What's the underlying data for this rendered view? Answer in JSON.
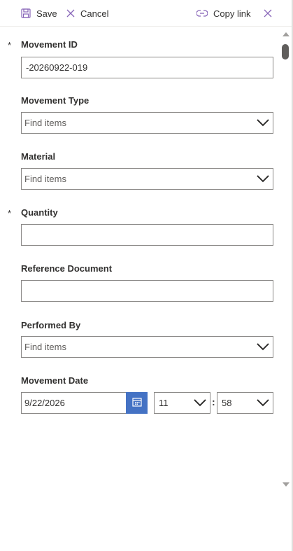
{
  "toolbar": {
    "save_label": "Save",
    "cancel_label": "Cancel",
    "copy_link_label": "Copy link"
  },
  "icons": {
    "save": "save-icon",
    "cancel": "cancel-icon",
    "copy_link": "link-icon",
    "close": "close-icon",
    "calendar": "calendar-icon",
    "chevron": "chevron-down-icon"
  },
  "colors": {
    "accent_icon": "#8764b8",
    "calendar_button": "#4472c4",
    "border": "#8a8886"
  },
  "form": {
    "required_mark": "*",
    "movement_id": {
      "label": "Movement ID",
      "value": "-20260922-019",
      "required": true
    },
    "movement_type": {
      "label": "Movement Type",
      "placeholder": "Find items"
    },
    "material": {
      "label": "Material",
      "placeholder": "Find items"
    },
    "quantity": {
      "label": "Quantity",
      "value": "",
      "required": true
    },
    "reference_document": {
      "label": "Reference Document",
      "value": ""
    },
    "performed_by": {
      "label": "Performed By",
      "placeholder": "Find items"
    },
    "movement_date": {
      "label": "Movement Date",
      "date": "9/22/2026",
      "hour": "11",
      "minute": "58",
      "separator": ":"
    }
  }
}
